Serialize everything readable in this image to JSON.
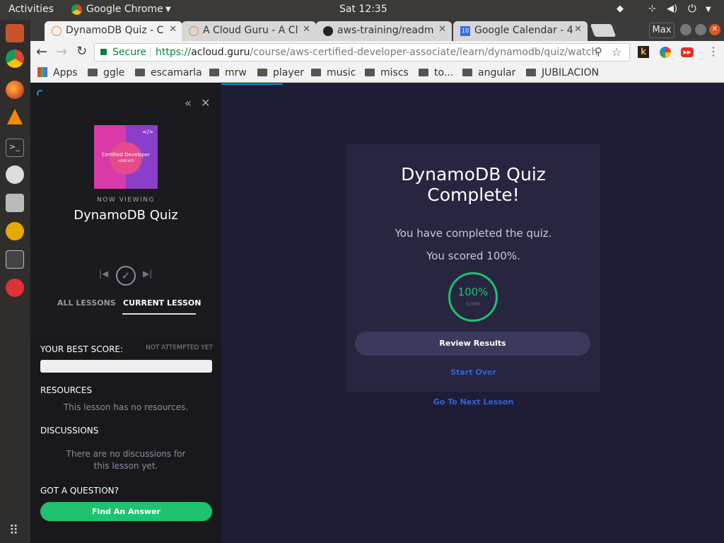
{
  "system_bar": {
    "activities": "Activities",
    "app_name": "Google Chrome",
    "clock": "Sat 12:35"
  },
  "browser": {
    "tabs": [
      {
        "title": "DynamoDB Quiz - C",
        "active": true
      },
      {
        "title": "A Cloud Guru - A Cl",
        "active": false
      },
      {
        "title": "aws-training/readm",
        "active": false
      },
      {
        "title": "Google Calendar - 4",
        "active": false
      }
    ],
    "calendar_badge": "10",
    "profile": "Max",
    "address": {
      "secure_label": "Secure",
      "scheme": "https://",
      "domain": "acloud.guru",
      "path": "/course/aws-certified-developer-associate/learn/dynamodb/quiz/watch"
    },
    "bookmarks": [
      "Apps",
      "ggle",
      "escamarla",
      "mrw",
      "player",
      "music",
      "miscs",
      "to...",
      "angular",
      "JUBILACION"
    ],
    "extension_letter": "k"
  },
  "sidebar": {
    "course_art_title": "Certified Developer",
    "course_art_subtitle": "ASSOCIATE",
    "now_viewing": "NOW VIEWING",
    "lesson_title": "DynamoDB Quiz",
    "tabs": {
      "all": "ALL LESSONS",
      "current": "CURRENT LESSON"
    },
    "best_score_label": "YOUR BEST SCORE:",
    "best_score_value": "NOT ATTEMPTED YET",
    "best_score_fraction": 0,
    "resources_heading": "RESOURCES",
    "resources_text": "This lesson has no resources.",
    "discussions_heading": "DISCUSSIONS",
    "discussions_line1": "There are no discussions for",
    "discussions_line2": "this lesson yet.",
    "question_heading": "GOT A QUESTION?",
    "find_answer": "Find An Answer"
  },
  "quiz": {
    "title_line1": "DynamoDB Quiz",
    "title_line2": "Complete!",
    "completed_text": "You have completed the quiz.",
    "scored_text": "You scored 100%.",
    "score_value": "100%",
    "score_label": "SCORE",
    "review_button": "Review Results",
    "start_over": "Start Over",
    "next_lesson": "Go To Next Lesson"
  },
  "colors": {
    "accent_green": "#1ec270",
    "link_blue": "#2d63e0",
    "page_bg": "#1f1d36",
    "card_bg": "#27253f"
  }
}
